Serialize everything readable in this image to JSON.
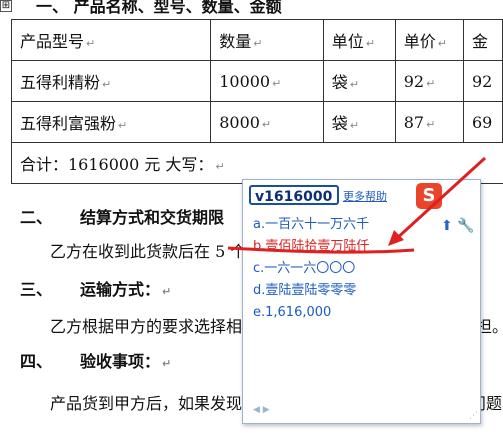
{
  "doc": {
    "heading_top": "一、  产品名称、型号、数量、金额",
    "table": {
      "header": [
        "产品型号",
        "数量",
        "单位",
        "单价",
        "金"
      ],
      "rows": [
        [
          "五得利精粉",
          "10000",
          "袋",
          "92",
          "92"
        ],
        [
          "五得利富强粉",
          "8000",
          "袋",
          "87",
          "69"
        ]
      ],
      "total_label": "合计：1616000 元   大写：",
      "move_handle": "⊞"
    },
    "sec2_num": "二、",
    "sec2_title": "结算方式和交货期限",
    "sec2_body": "乙方在收到此货款后在 5 个",
    "sec3_num": "三、",
    "sec3_title": "运输方式：",
    "sec3_body_a": "乙方根据甲方的要求选择相",
    "sec3_body_b": "乙方承担。",
    "sec4_num": "四、",
    "sec4_title": "验收事项：",
    "sec4_body_a": "产品货到甲方后，如果发现",
    "sec4_body_b": "小形问题，",
    "para_mark": "↵"
  },
  "ime": {
    "input": "v1616000",
    "help": "更多帮助",
    "logo": "S",
    "tools": "⬆ 🔧",
    "candidates": [
      "a.一百六十一万六千",
      "b.壹佰陆拾壹万陆仟",
      "c.一六一六〇〇〇",
      "d.壹陆壹陆零零零",
      "e.1,616,000"
    ],
    "pager": "◀ ▶",
    "grip": "⋰"
  },
  "annotation_color": "#e02020"
}
